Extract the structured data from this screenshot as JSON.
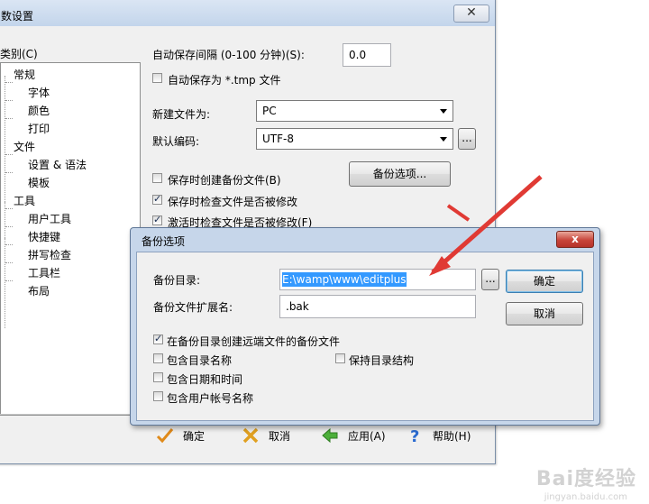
{
  "main": {
    "title": "数设置",
    "close_glyph": "✕",
    "category_label": "类别(C)",
    "tree": [
      {
        "label": "常规",
        "level": 0
      },
      {
        "label": "字体",
        "level": 1
      },
      {
        "label": "颜色",
        "level": 1
      },
      {
        "label": "打印",
        "level": 1
      },
      {
        "label": "文件",
        "level": 0
      },
      {
        "label": "设置 & 语法",
        "level": 1
      },
      {
        "label": "模板",
        "level": 1
      },
      {
        "label": "工具",
        "level": 0
      },
      {
        "label": "用户工具",
        "level": 1
      },
      {
        "label": "快捷键",
        "level": 1
      },
      {
        "label": "拼写检查",
        "level": 1
      },
      {
        "label": "工具栏",
        "level": 1
      },
      {
        "label": "布局",
        "level": 1
      }
    ],
    "autosave_label": "自动保存间隔 (0-100 分钟)(S):",
    "autosave_value": "0.0",
    "autosave_tmp_label": "自动保存为 *.tmp 文件",
    "new_file_label": "新建文件为:",
    "new_file_value": "PC",
    "encoding_label": "默认编码:",
    "encoding_value": "UTF-8",
    "ellipsis": "...",
    "backup_on_save_label": "保存时创建备份文件(B)",
    "backup_options_button": "备份选项...",
    "check_modified_save_label": "保存时检查文件是否被修改",
    "check_modified_activate_label": "激活时检查文件是否被修改(F)",
    "footer": {
      "ok": "确定",
      "cancel": "取消",
      "apply": "应用(A)",
      "help": "帮助(H)"
    }
  },
  "backup": {
    "title": "备份选项",
    "close_glyph": "x",
    "dir_label": "备份目录:",
    "dir_value": "E:\\wamp\\www\\editplus",
    "ext_label": "备份文件扩展名:",
    "ext_value": ".bak",
    "ellipsis": "...",
    "ok": "确定",
    "cancel": "取消",
    "opt_remote": "在备份目录创建远端文件的备份文件",
    "opt_dirname": "包含目录名称",
    "opt_keep_structure": "保持目录结构",
    "opt_datetime": "包含日期和时间",
    "opt_username": "包含用户帐号名称"
  },
  "watermark": {
    "brand": "Bai度经验",
    "url": "jingyan.baidu.com"
  },
  "colors": {
    "arrow": "#e03a34",
    "selection": "#3399ff"
  }
}
